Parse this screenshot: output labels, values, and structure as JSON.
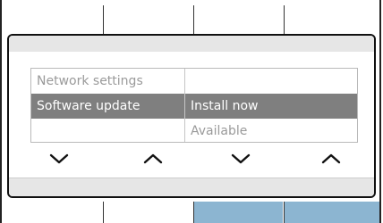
{
  "menu": {
    "items": [
      {
        "label": "Network settings",
        "state": "normal"
      },
      {
        "label": "Software update",
        "state": "selected"
      }
    ],
    "values": [
      {
        "label": "Install now",
        "state": "selected"
      },
      {
        "label": "Available",
        "state": "normal"
      }
    ]
  },
  "navigation": {
    "buttons": [
      {
        "icon": "chevron-down-icon"
      },
      {
        "icon": "chevron-up-icon"
      },
      {
        "icon": "chevron-down-icon"
      },
      {
        "icon": "chevron-up-icon"
      }
    ]
  },
  "colors": {
    "selected_bar": "#7f7f7f",
    "text_muted": "#9a9a9a",
    "active_softkey": "#8cb5d1"
  }
}
